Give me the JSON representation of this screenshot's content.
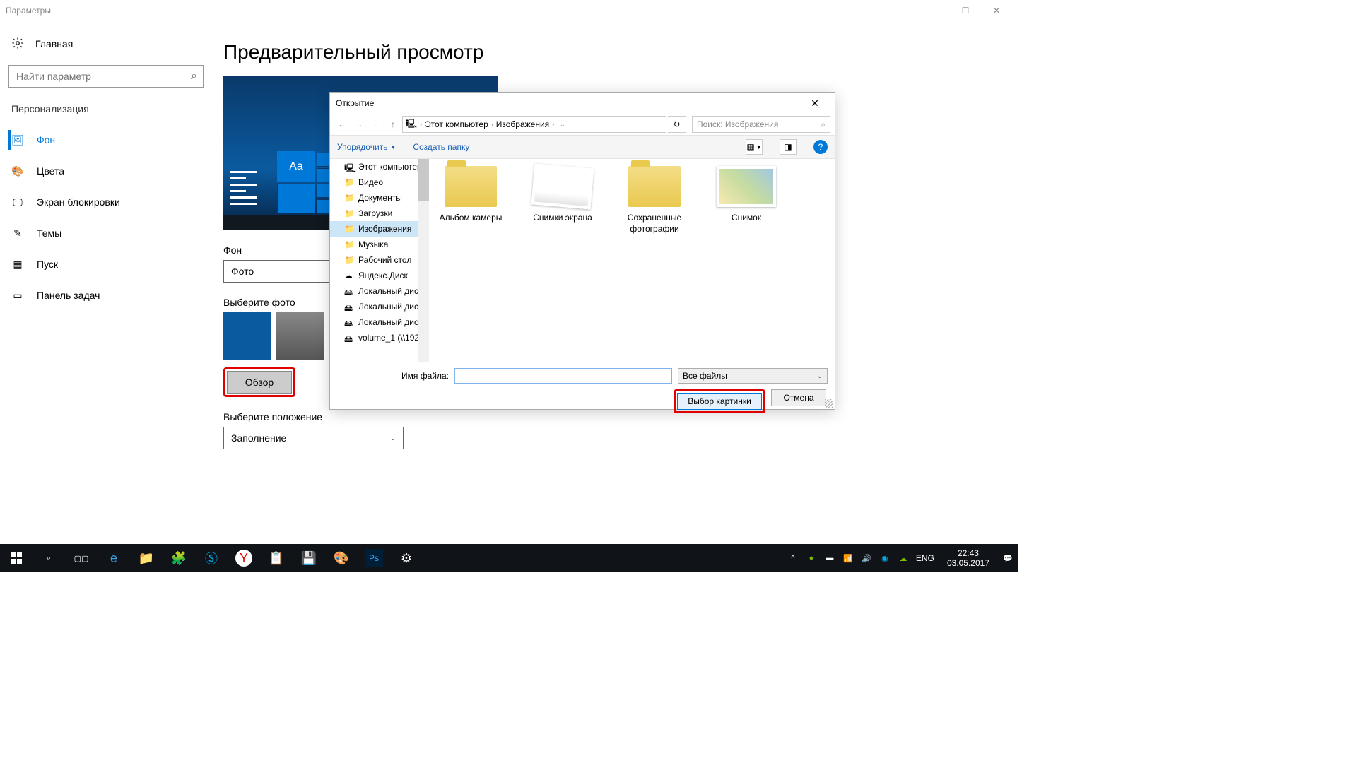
{
  "window": {
    "title": "Параметры"
  },
  "sidebar": {
    "home": "Главная",
    "search_placeholder": "Найти параметр",
    "section": "Персонализация",
    "items": [
      {
        "label": "Фон"
      },
      {
        "label": "Цвета"
      },
      {
        "label": "Экран блокировки"
      },
      {
        "label": "Темы"
      },
      {
        "label": "Пуск"
      },
      {
        "label": "Панель задач"
      }
    ]
  },
  "main": {
    "heading": "Предварительный просмотр",
    "preview_sample": "Aa",
    "bg_label": "Фон",
    "bg_value": "Фото",
    "choose_label": "Выберите фото",
    "browse_btn": "Обзор",
    "position_label": "Выберите положение",
    "position_value": "Заполнение"
  },
  "dialog": {
    "title": "Открытие",
    "breadcrumb": [
      "Этот компьютер",
      "Изображения"
    ],
    "search_placeholder": "Поиск: Изображения",
    "organize": "Упорядочить",
    "new_folder": "Создать папку",
    "tree": [
      "Этот компьютер",
      "Видео",
      "Документы",
      "Загрузки",
      "Изображения",
      "Музыка",
      "Рабочий стол",
      "Яндекс.Диск",
      "Локальный диск",
      "Локальный диск",
      "Локальный диск",
      "volume_1 (\\\\192"
    ],
    "tree_selected_index": 4,
    "files": [
      {
        "name": "Альбом камеры",
        "type": "folder"
      },
      {
        "name": "Снимки экрана",
        "type": "thumb1"
      },
      {
        "name": "Сохраненные фотографии",
        "type": "folder"
      },
      {
        "name": "Снимок",
        "type": "thumb2"
      }
    ],
    "filename_label": "Имя файла:",
    "filetype": "Все файлы",
    "open_btn": "Выбор картинки",
    "cancel_btn": "Отмена"
  },
  "taskbar": {
    "lang": "ENG",
    "time": "22:43",
    "date": "03.05.2017"
  }
}
